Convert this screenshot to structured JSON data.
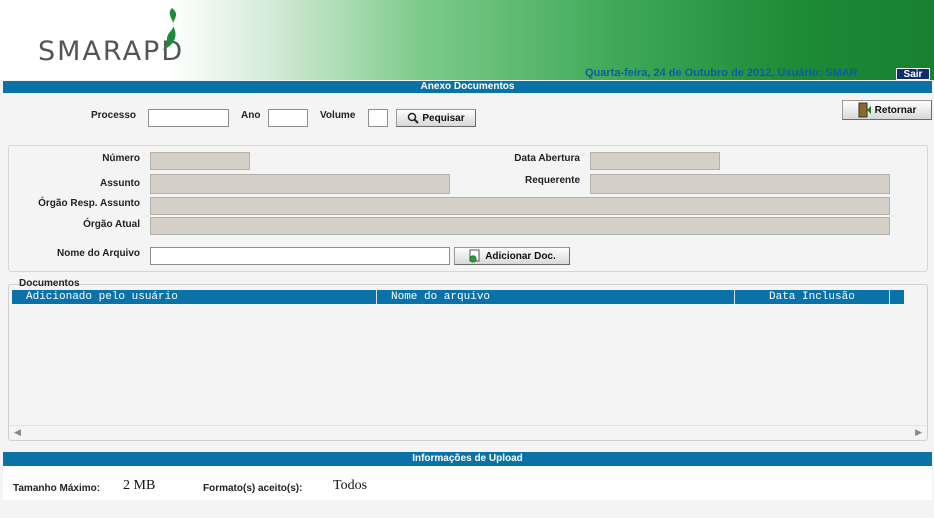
{
  "header": {
    "logo_text": "SMARAPD",
    "date_user": "Quarta-feira, 24 de Outubro de 2012, Usuário: SMAR",
    "logout_label": "Sair",
    "gradient_colors": [
      "#ffffff",
      "#7dcb8a",
      "#17812f"
    ]
  },
  "page": {
    "title": "Anexo Documentos"
  },
  "search": {
    "processo_label": "Processo",
    "processo_value": "",
    "ano_label": "Ano",
    "ano_value": "",
    "volume_label": "Volume",
    "volume_value": "",
    "search_button": "Pequisar",
    "search_icon": "magnifier-icon",
    "back_button": "Retornar",
    "back_icon": "door-exit-icon"
  },
  "details": {
    "numero_label": "Número",
    "numero_value": "",
    "data_abertura_label": "Data Abertura",
    "data_abertura_value": "",
    "assunto_label": "Assunto",
    "assunto_value": "",
    "requerente_label": "Requerente",
    "requerente_value": "",
    "orgao_resp_label": "Órgão Resp. Assunto",
    "orgao_resp_value": "",
    "orgao_atual_label": "Órgão Atual",
    "orgao_atual_value": "",
    "nome_arquivo_label": "Nome do Arquivo",
    "nome_arquivo_value": "",
    "add_doc_button": "Adicionar Doc.",
    "add_doc_icon": "add-document-icon"
  },
  "documents": {
    "section_label": "Documentos",
    "columns": [
      "Adicionado pelo usuário",
      "Nome do arquivo",
      "Data Inclusão"
    ],
    "rows": []
  },
  "upload": {
    "bar_title": "Informações de Upload",
    "max_size_label": "Tamanho Máximo:",
    "max_size_value": "2 MB",
    "formats_label": "Formato(s) aceito(s):",
    "formats_value": "Todos"
  },
  "colors": {
    "accent_blue": "#0b72a8",
    "readonly_gray": "#d4d0c8",
    "header_text_blue": "#0a5fa0"
  }
}
